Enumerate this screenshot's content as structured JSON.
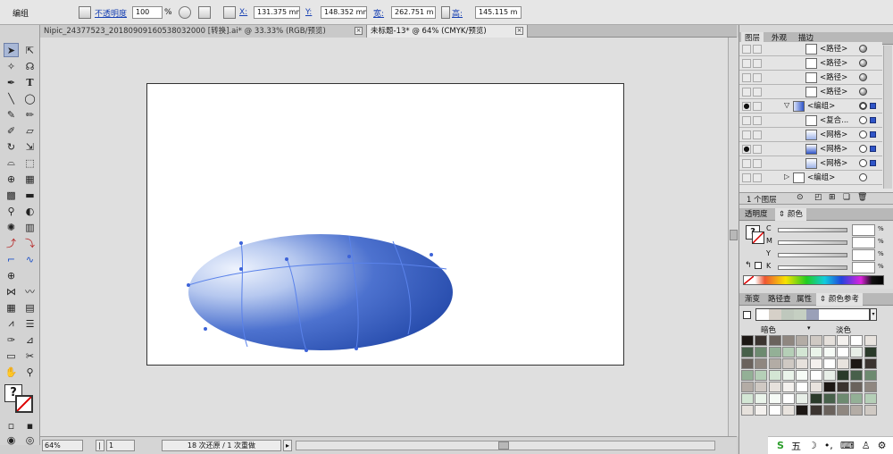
{
  "control_bar": {
    "selection_type": "编组",
    "opacity_label": "不透明度",
    "opacity_value": "100",
    "opacity_unit": "%",
    "x_label": "X:",
    "x_value": "131.375 mm",
    "y_label": "Y:",
    "y_value": "148.352 mm",
    "w_label": "宽:",
    "w_value": "262.751 m",
    "h_label": "高:",
    "h_value": "145.115 m"
  },
  "doc_tabs": [
    {
      "label": "Nipic_24377523_20180909160538032000  [转换].ai* @ 33.33% (RGB/预览)",
      "active": false
    },
    {
      "label": "未标题-13* @ 64% (CMYK/预览)",
      "active": true
    }
  ],
  "status_bar": {
    "zoom": "64%",
    "artboard": "1",
    "history": "18 次还原 / 1 次重做"
  },
  "layers_panel": {
    "tabs": [
      "图层",
      "外观",
      "描边"
    ],
    "rows": [
      {
        "name": "<路径>",
        "indent": 1,
        "visible": false,
        "target": "filled"
      },
      {
        "name": "<路径>",
        "indent": 1,
        "visible": false,
        "target": "filled"
      },
      {
        "name": "<路径>",
        "indent": 1,
        "visible": false,
        "target": "filled"
      },
      {
        "name": "<路径>",
        "indent": 1,
        "visible": false,
        "target": "filled"
      },
      {
        "name": "<编组>",
        "indent": 0,
        "visible": true,
        "target": "ring",
        "selected": true
      },
      {
        "name": "<复合...",
        "indent": 1,
        "visible": false,
        "target": "empty",
        "selected": true
      },
      {
        "name": "<网格>",
        "indent": 1,
        "visible": false,
        "target": "empty",
        "selected": true
      },
      {
        "name": "<网格>",
        "indent": 1,
        "visible": true,
        "target": "empty",
        "selected": true
      },
      {
        "name": "<网格>",
        "indent": 1,
        "visible": false,
        "target": "empty",
        "selected": true
      },
      {
        "name": "<编组>",
        "indent": 0,
        "visible": false,
        "target": "empty"
      }
    ],
    "footer": "1 个图层"
  },
  "color_panel": {
    "tabs": [
      "透明度",
      "颜色"
    ],
    "channels": [
      "C",
      "M",
      "Y",
      "K"
    ],
    "unit": "%"
  },
  "guide_panel": {
    "tabs": [
      "渐变",
      "路径查",
      "属性",
      "颜色参考"
    ],
    "left_label": "暗色",
    "right_label": "淡色"
  },
  "colors": {
    "accent": "#2f55c8",
    "ellipse_dark": "#2148a7",
    "ellipse_light": "#e8eefb",
    "mesh_line": "#5a82ea"
  }
}
